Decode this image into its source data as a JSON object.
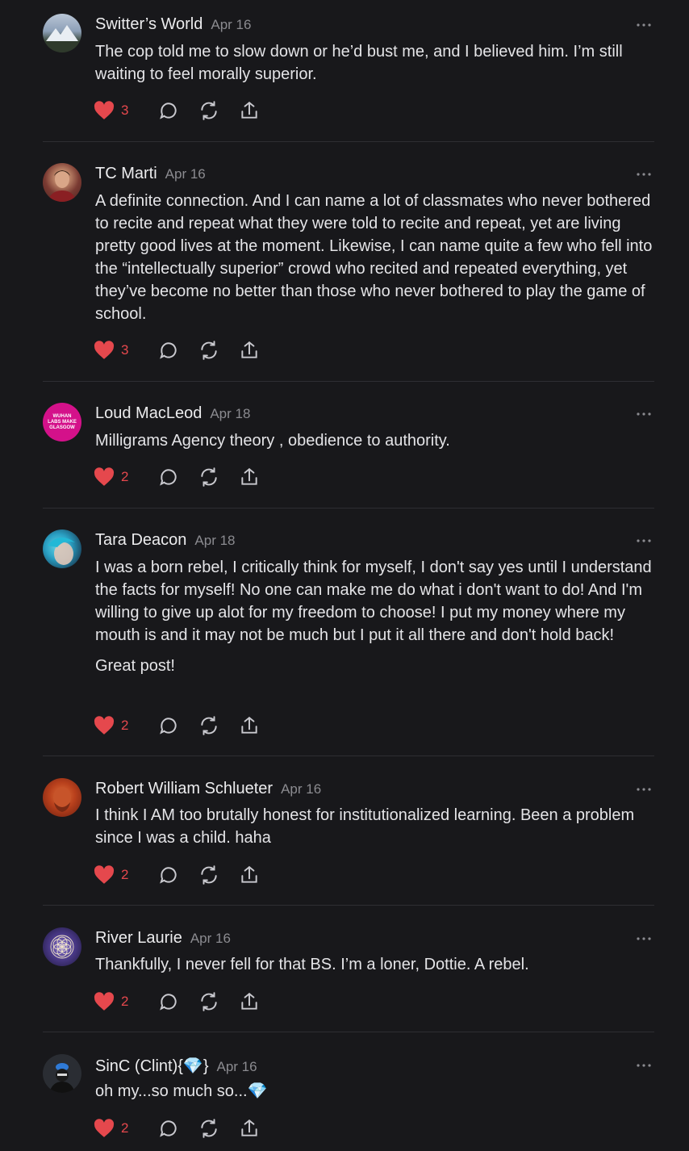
{
  "comments": [
    {
      "author": "Switter’s World",
      "date": "Apr 16",
      "paragraphs": [
        "The cop told me to slow down or he’d bust me, and I believed him. I’m still waiting to feel morally superior."
      ],
      "likes": "3"
    },
    {
      "author": "TC Marti",
      "date": "Apr 16",
      "paragraphs": [
        "A definite connection. And I can name a lot of classmates who never bothered to recite and repeat what they were told to recite and repeat, yet are living pretty good lives at the moment. Likewise, I can name quite a few who fell into the “intellectually superior” crowd who recited and repeated everything, yet they’ve become no better than those who never bothered to play the game of school."
      ],
      "likes": "3"
    },
    {
      "author": "Loud MacLeod",
      "date": "Apr 18",
      "avatar_text": "WUHAN LABS MAKE GLASGOW",
      "paragraphs": [
        "Milligrams Agency theory , obedience to authority."
      ],
      "likes": "2"
    },
    {
      "author": "Tara Deacon",
      "date": "Apr 18",
      "paragraphs": [
        "I was a born rebel, I critically think for myself, I don't say yes until I understand the facts for myself! No one can make me do what i don't want to do! And I'm willing to give up alot for my freedom to choose! I put my money where my mouth is and it may not be much but I put it all there and don't hold back!",
        "Great post!"
      ],
      "likes": "2"
    },
    {
      "author": "Robert William Schlueter",
      "date": "Apr 16",
      "paragraphs": [
        "I think I AM too brutally honest for institutionalized learning. Been a problem since I was a child. haha"
      ],
      "likes": "2"
    },
    {
      "author": "River Laurie",
      "date": "Apr 16",
      "paragraphs": [
        "Thankfully, I never fell for that BS. I’m a loner, Dottie. A rebel."
      ],
      "likes": "2"
    },
    {
      "author": "SinC (Clint){💎}",
      "date": "Apr 16",
      "paragraphs": [
        "oh my...so much so...💎"
      ],
      "likes": "2"
    }
  ],
  "colors": {
    "background": "#18181b",
    "like": "#e5484d",
    "muted": "#8b8b90"
  },
  "icons": [
    "heart-icon",
    "comment-icon",
    "restack-icon",
    "share-icon",
    "more-icon"
  ]
}
